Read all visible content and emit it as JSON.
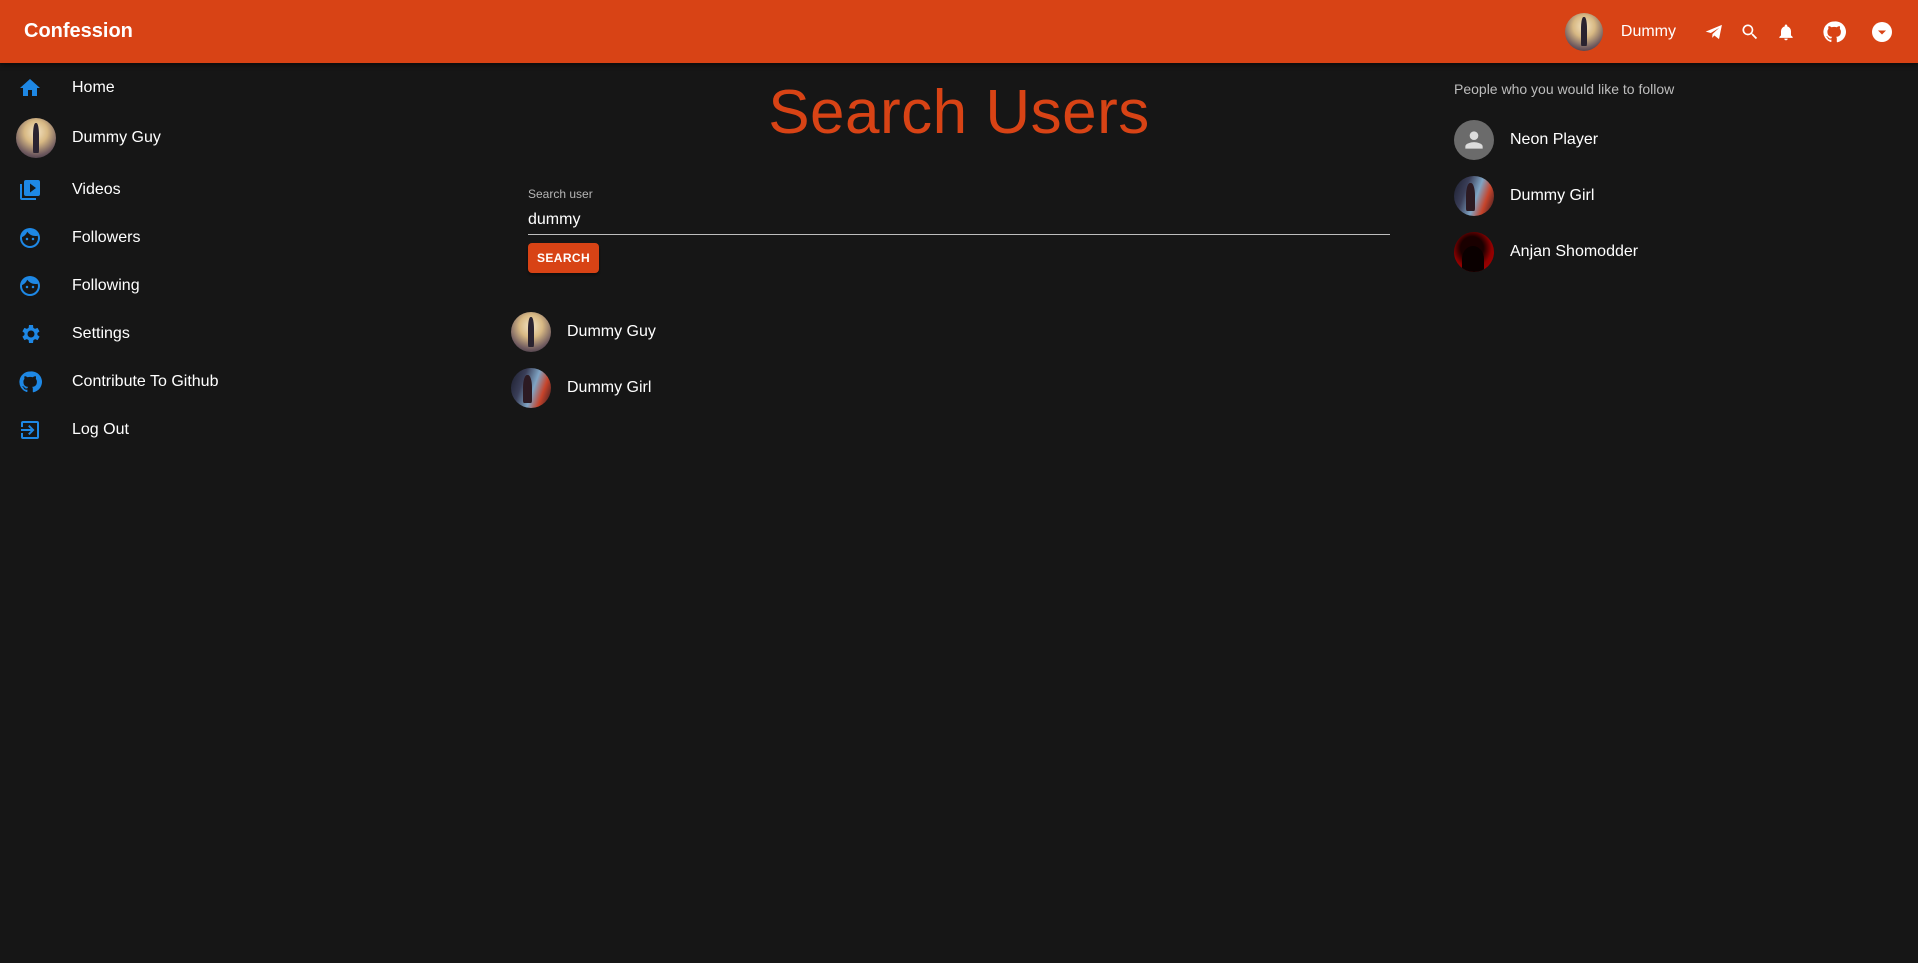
{
  "appbar": {
    "brand": "Confession",
    "username": "Dummy",
    "icons": [
      "telegram-icon",
      "search-icon",
      "notifications-icon",
      "github-icon",
      "expand-more-icon"
    ]
  },
  "colors": {
    "primary": "#d84315",
    "nav_icon": "#1e88e5",
    "background": "#161616"
  },
  "sidebar": {
    "items": [
      {
        "label": "Home",
        "icon": "home-icon"
      },
      {
        "label": "Dummy Guy",
        "icon": "profile-avatar"
      },
      {
        "label": "Videos",
        "icon": "video-library-icon"
      },
      {
        "label": "Followers",
        "icon": "face-icon"
      },
      {
        "label": "Following",
        "icon": "face-icon"
      },
      {
        "label": "Settings",
        "icon": "gear-icon"
      },
      {
        "label": "Contribute To Github",
        "icon": "github-icon"
      },
      {
        "label": "Log Out",
        "icon": "logout-icon"
      }
    ]
  },
  "main": {
    "title": "Search Users",
    "search": {
      "label": "Search user",
      "value": "dummy",
      "button": "SEARCH"
    },
    "results": [
      {
        "name": "Dummy Guy"
      },
      {
        "name": "Dummy Girl"
      }
    ]
  },
  "suggestions": {
    "title": "People who you would like to follow",
    "people": [
      {
        "name": "Neon Player"
      },
      {
        "name": "Dummy Girl"
      },
      {
        "name": "Anjan Shomodder"
      }
    ]
  }
}
